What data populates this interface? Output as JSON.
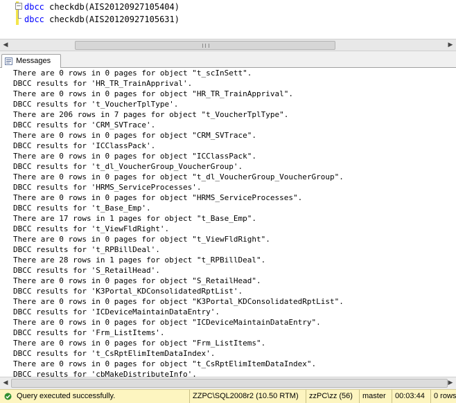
{
  "editor": {
    "lines": [
      {
        "keyword": "dbcc",
        "text": " checkdb(AIS20120927105404)"
      },
      {
        "keyword": "dbcc",
        "text": " checkdb(AIS20120927105631)"
      }
    ],
    "fold_symbol": "−"
  },
  "results_tabs": [
    {
      "label": "Messages",
      "icon": "messages-icon"
    }
  ],
  "messages": [
    "There are 0 rows in 0 pages for object \"t_scInSett\".",
    "DBCC results for 'HR_TR_TrainApprival'.",
    "There are 0 rows in 0 pages for object \"HR_TR_TrainApprival\".",
    "DBCC results for 't_VoucherTplType'.",
    "There are 206 rows in 7 pages for object \"t_VoucherTplType\".",
    "DBCC results for 'CRM_SVTrace'.",
    "There are 0 rows in 0 pages for object \"CRM_SVTrace\".",
    "DBCC results for 'ICClassPack'.",
    "There are 0 rows in 0 pages for object \"ICClassPack\".",
    "DBCC results for 't_dl_VoucherGroup_VoucherGroup'.",
    "There are 0 rows in 0 pages for object \"t_dl_VoucherGroup_VoucherGroup\".",
    "DBCC results for 'HRMS_ServiceProcesses'.",
    "There are 0 rows in 0 pages for object \"HRMS_ServiceProcesses\".",
    "DBCC results for 't_Base_Emp'.",
    "There are 17 rows in 1 pages for object \"t_Base_Emp\".",
    "DBCC results for 't_ViewFldRight'.",
    "There are 0 rows in 0 pages for object \"t_ViewFldRight\".",
    "DBCC results for 't_RPBillDeal'.",
    "There are 28 rows in 1 pages for object \"t_RPBillDeal\".",
    "DBCC results for 'S_RetailHead'.",
    "There are 0 rows in 0 pages for object \"S_RetailHead\".",
    "DBCC results for 'K3Portal_KDConsolidatedRptList'.",
    "There are 0 rows in 0 pages for object \"K3Portal_KDConsolidatedRptList\".",
    "DBCC results for 'ICDeviceMaintainDataEntry'.",
    "There are 0 rows in 0 pages for object \"ICDeviceMaintainDataEntry\".",
    "DBCC results for 'Frm_ListItems'.",
    "There are 0 rows in 0 pages for object \"Frm_ListItems\".",
    "DBCC results for 't_CsRptElimItemDataIndex'.",
    "There are 0 rows in 0 pages for object \"t_CsRptElimItemDataIndex\".",
    "DBCC results for 'cbMakeDistributeInfo'."
  ],
  "scroll_arrows": {
    "left": "◀",
    "right": "▶"
  },
  "status_bar": {
    "message": "Query executed successfully.",
    "server": "ZZPC\\SQL2008r2 (10.50 RTM)",
    "user": "zzPC\\zz (56)",
    "database": "master",
    "elapsed": "00:03:44",
    "rows": "0 rows"
  },
  "colors": {
    "keyword": "#0000ff",
    "status_bar_bg": "#fdf5c0",
    "change_bar": "#f4e64c"
  }
}
